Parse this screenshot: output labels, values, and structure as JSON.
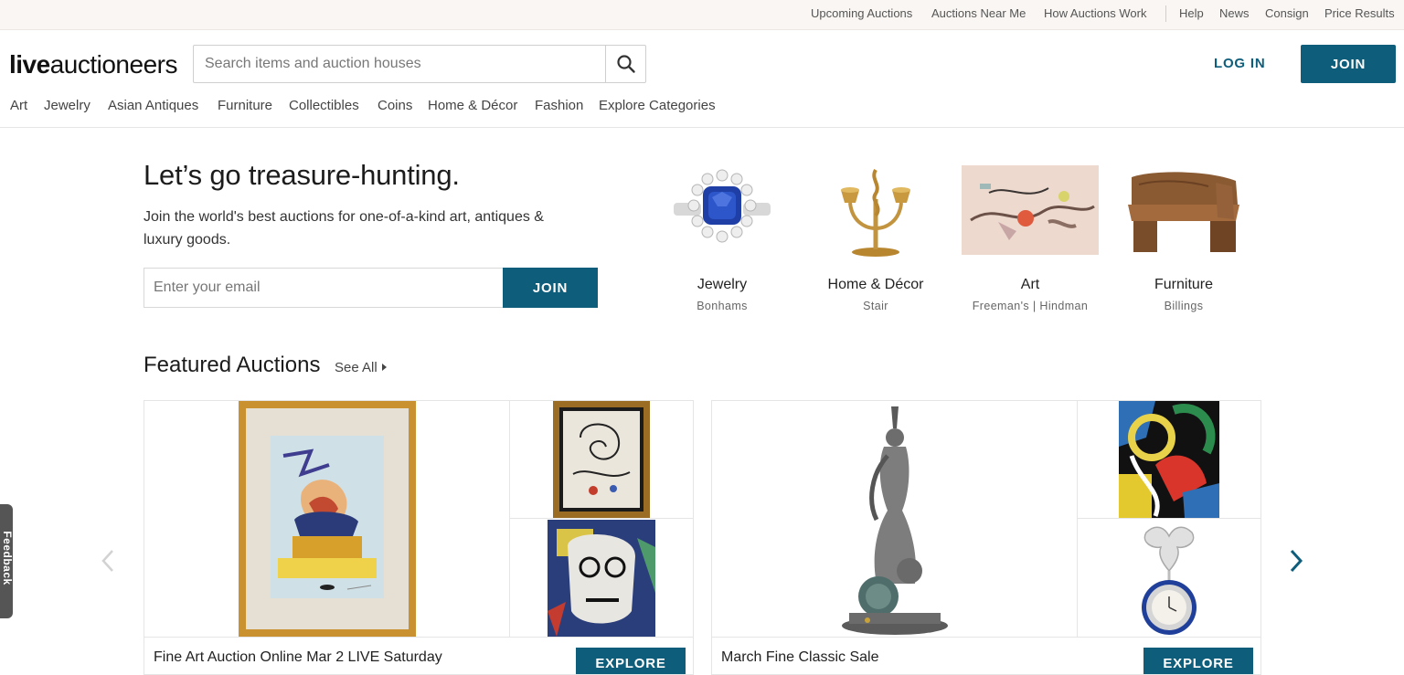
{
  "utility_nav": {
    "links": [
      "Upcoming Auctions",
      "Auctions Near Me",
      "How Auctions Work",
      "Help",
      "News",
      "Consign",
      "Price Results"
    ]
  },
  "header": {
    "logo_bold": "live",
    "logo_light": "auctioneers",
    "search_placeholder": "Search items and auction houses",
    "login_label": "LOG IN",
    "join_label": "JOIN"
  },
  "categories_nav": [
    "Art",
    "Jewelry",
    "Asian Antiques",
    "Furniture",
    "Collectibles",
    "Coins",
    "Home & Décor",
    "Fashion",
    "Explore Categories"
  ],
  "hero": {
    "title": "Let’s go treasure-hunting.",
    "subtitle": "Join the world's best auctions for one-of-a-kind art, antiques & luxury goods.",
    "email_placeholder": "Enter your email",
    "join_label": "JOIN"
  },
  "category_cards": [
    {
      "name": "Jewelry",
      "houses": "Bonhams",
      "icon": "sapphire-ring"
    },
    {
      "name": "Home & Décor",
      "houses": "Stair",
      "icon": "brass-candelabra"
    },
    {
      "name": "Art",
      "houses": "Freeman's | Hindman",
      "icon": "abstract-painting"
    },
    {
      "name": "Furniture",
      "houses": "Billings",
      "icon": "wooden-bench"
    }
  ],
  "featured": {
    "title": "Featured Auctions",
    "see_all": "See All",
    "auctions": [
      {
        "title": "Fine Art Auction Online Mar 2 LIVE Saturday",
        "button": "EXPLORE"
      },
      {
        "title": "March Fine Classic Sale",
        "button": "EXPLORE"
      }
    ]
  },
  "feedback_tab": "Feedback",
  "colors": {
    "brand": "#0e5d7b",
    "utility_bg": "#f9f6f3"
  }
}
